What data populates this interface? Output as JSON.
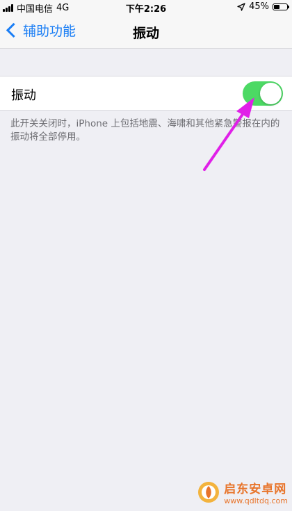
{
  "status_bar": {
    "carrier": "中国电信",
    "network": "4G",
    "time": "下午2:26",
    "battery_percent": "45%",
    "battery_level": 0.45,
    "icons": [
      "signal-icon",
      "location-icon",
      "battery-icon"
    ]
  },
  "nav": {
    "back_label": "辅助功能",
    "title": "振动",
    "accent_color": "#1a7ef5"
  },
  "settings": {
    "row_label": "振动",
    "toggle_on": true,
    "toggle_color": "#4cd964",
    "footer_note": "此开关关闭时，iPhone 上包括地震、海啸和其他紧急警报在内的振动将全部停用。"
  },
  "annotation": {
    "arrow_color": "#e020e8"
  },
  "watermark": {
    "brand": "启东安卓网",
    "url": "www.qdltdq.com"
  }
}
